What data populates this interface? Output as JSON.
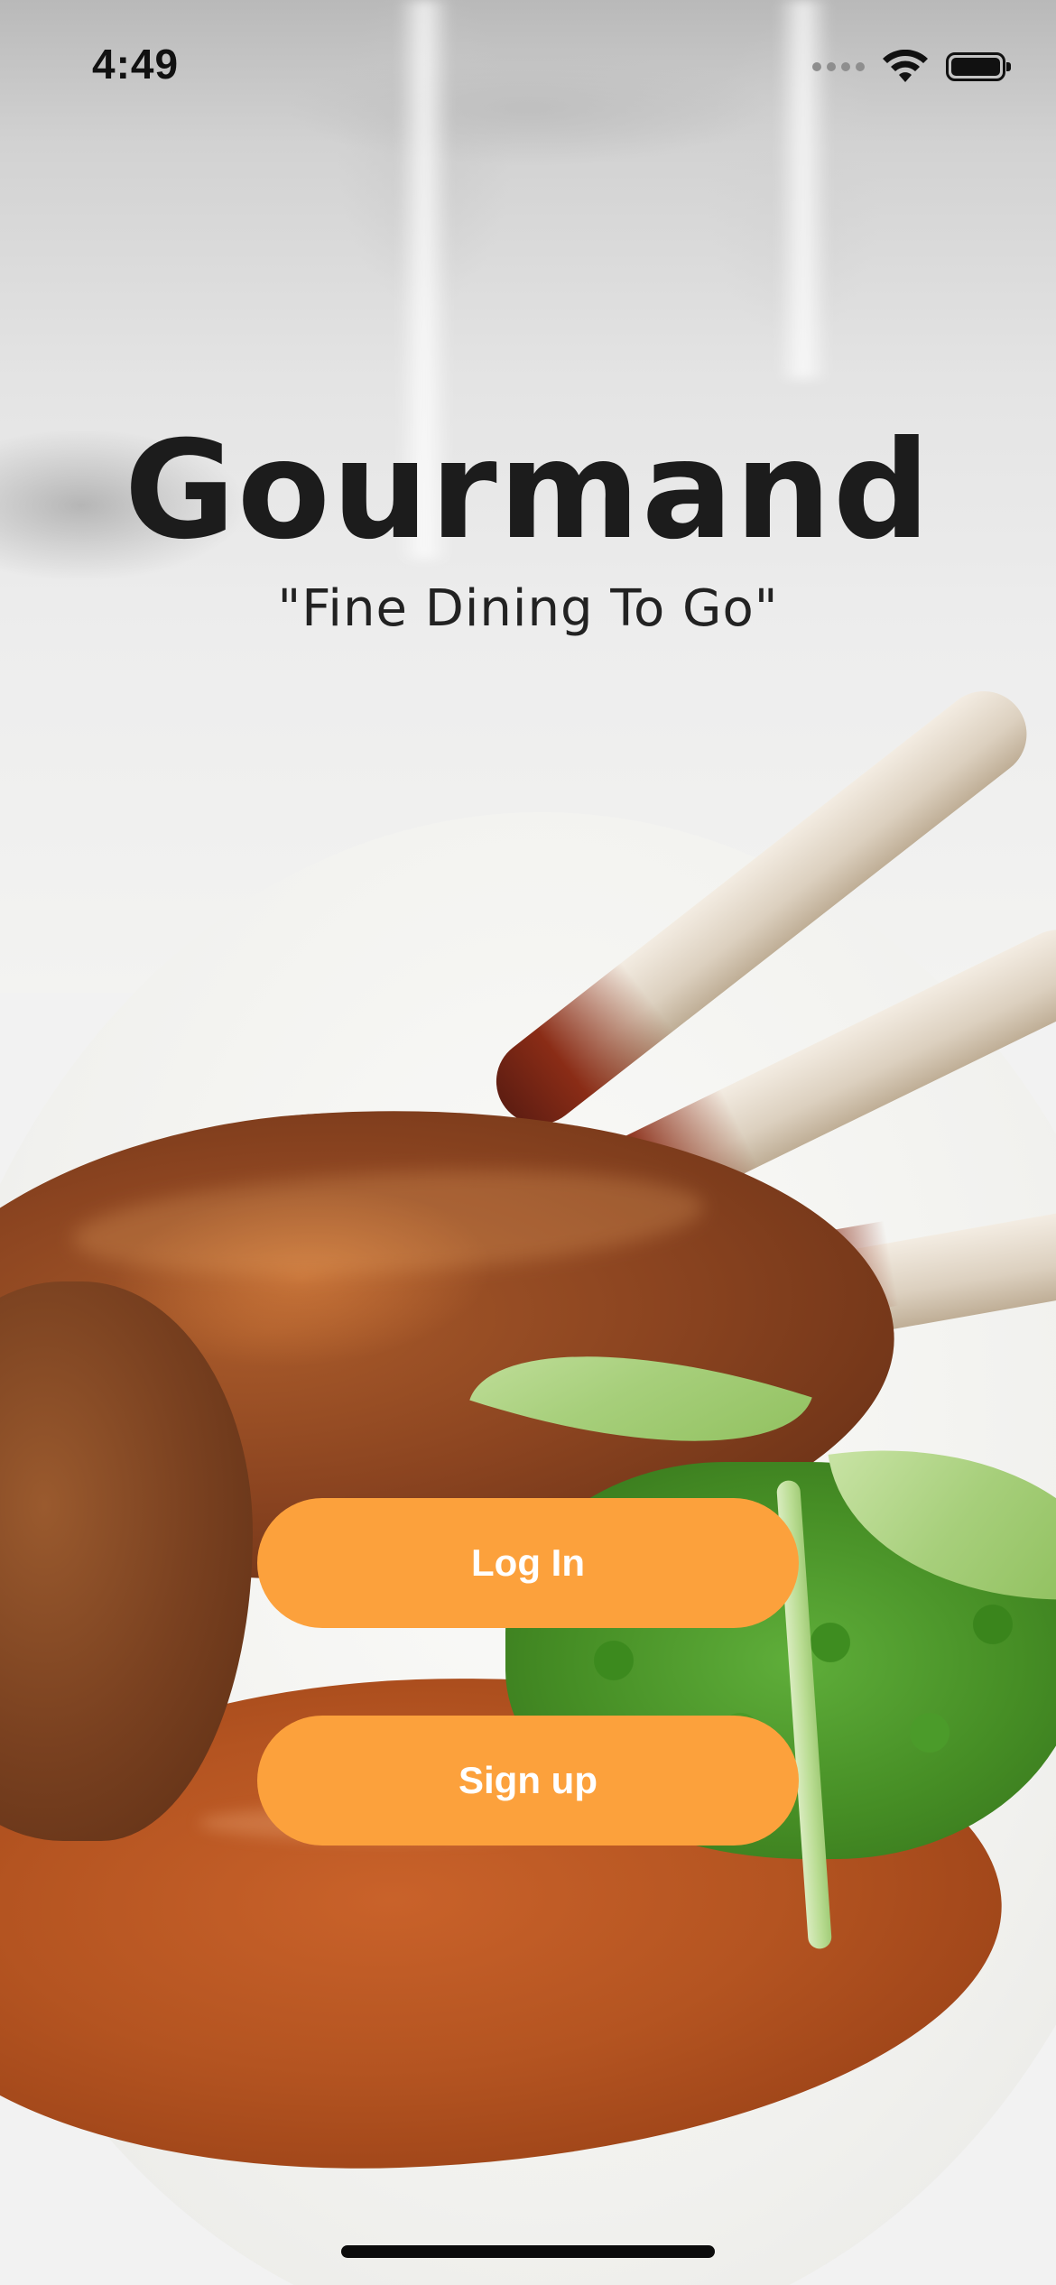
{
  "status_bar": {
    "time": "4:49",
    "icons": [
      "signal-dots-icon",
      "wifi-icon",
      "battery-icon"
    ]
  },
  "app": {
    "title": "Gourmand",
    "tagline": "\"Fine Dining To Go\""
  },
  "actions": {
    "login_label": "Log In",
    "signup_label": "Sign up"
  },
  "colors": {
    "button_background": "#fca13c",
    "button_text": "#ffffff",
    "title_text": "#1c1c1c"
  },
  "background": {
    "image": "food-photo"
  }
}
